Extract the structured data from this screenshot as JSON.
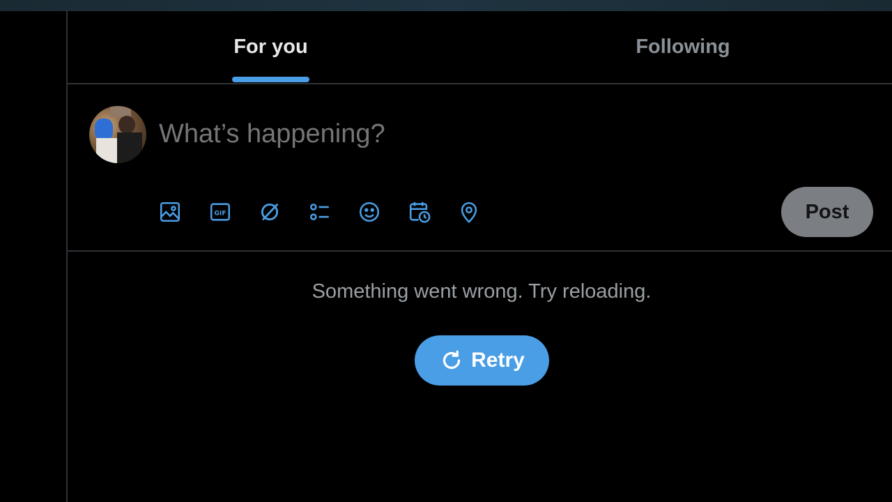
{
  "tabs": [
    {
      "label": "For you",
      "active": true
    },
    {
      "label": "Following",
      "active": false
    }
  ],
  "composer": {
    "placeholder": "What’s happening?",
    "tools": [
      "image-icon",
      "gif-icon",
      "grok-icon",
      "poll-icon",
      "emoji-icon",
      "schedule-icon",
      "location-icon"
    ],
    "post_label": "Post"
  },
  "feed": {
    "error_message": "Something went wrong. Try reloading.",
    "retry_label": "Retry"
  },
  "colors": {
    "accent": "#4a9ee6",
    "background": "#000000",
    "divider": "#2f3336",
    "post_disabled": "#7b7f83"
  }
}
